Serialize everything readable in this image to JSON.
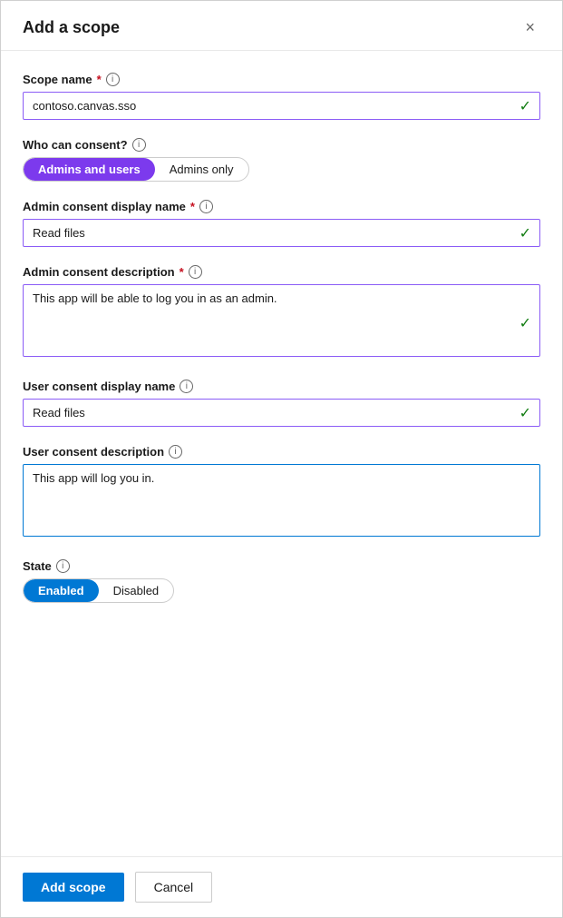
{
  "dialog": {
    "title": "Add a scope",
    "close_label": "×"
  },
  "form": {
    "scope_name_label": "Scope name",
    "scope_name_value": "contoso.canvas.sso",
    "who_can_consent_label": "Who can consent?",
    "consent_option_admins_users": "Admins and users",
    "consent_option_admins_only": "Admins only",
    "admin_consent_display_name_label": "Admin consent display name",
    "admin_consent_display_name_value": "Read files",
    "admin_consent_description_label": "Admin consent description",
    "admin_consent_description_value": "This app will be able to log you in as an admin.",
    "user_consent_display_name_label": "User consent display name",
    "user_consent_display_name_value": "Read files",
    "user_consent_description_label": "User consent description",
    "user_consent_description_value": "This app will log you in.",
    "state_label": "State",
    "state_option_enabled": "Enabled",
    "state_option_disabled": "Disabled"
  },
  "footer": {
    "add_scope_label": "Add scope",
    "cancel_label": "Cancel"
  },
  "icons": {
    "info": "i",
    "check": "✓",
    "close": "✕"
  }
}
